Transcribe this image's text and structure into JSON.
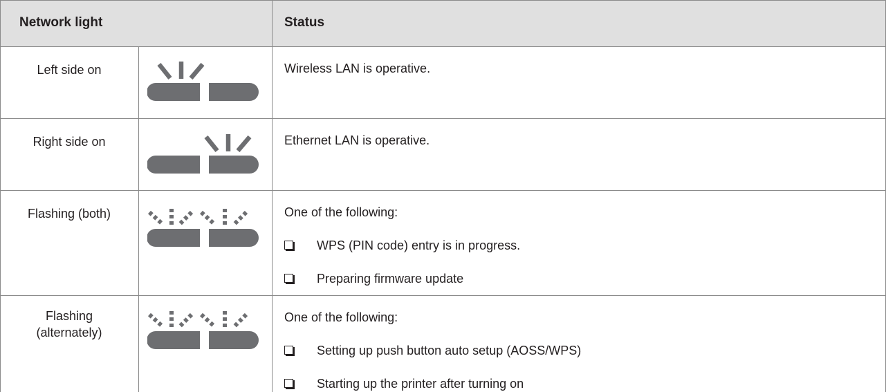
{
  "header": {
    "col1": "Network light",
    "col2": "Status"
  },
  "rows": [
    {
      "light": "Left side on",
      "icon": "network-light-left-on-icon",
      "status": "Wireless LAN is operative."
    },
    {
      "light": "Right side on",
      "icon": "network-light-right-on-icon",
      "status": "Ethernet LAN is operative."
    },
    {
      "light": "Flashing (both)",
      "icon": "network-light-both-flashing-icon",
      "status": "One of the following:",
      "bullets": [
        "WPS (PIN code) entry is in progress.",
        "Preparing firmware update"
      ]
    },
    {
      "light_line1": "Flashing",
      "light_line2": "(alternately)",
      "icon": "network-light-alternate-flashing-icon",
      "status": "One of the following:",
      "bullets": [
        "Setting up push button auto setup (AOSS/WPS)",
        "Starting up the printer after turning on"
      ]
    }
  ],
  "colors": {
    "header_bg": "#e0e0e0",
    "grid_line": "#8a8a8a",
    "lamp_fill": "#6d6e71",
    "text": "#231f20"
  }
}
